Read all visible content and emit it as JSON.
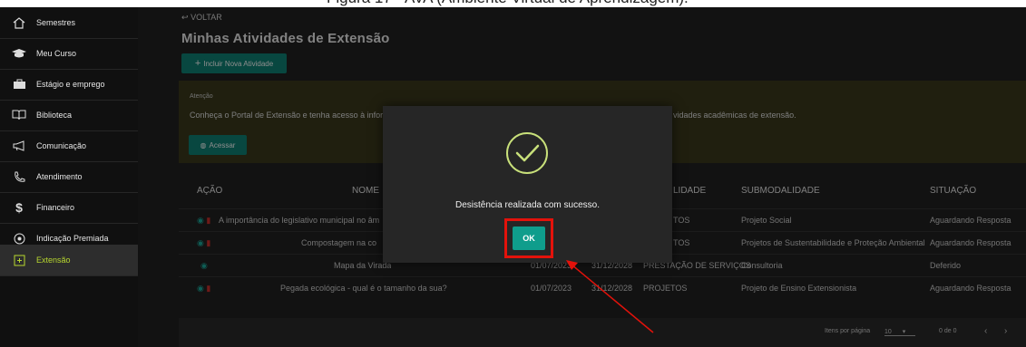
{
  "caption": "Figura 17 - AVA (Ambiente Virtual de Aprendizagem).",
  "sidebar": {
    "items": [
      {
        "label": "Semestres",
        "icon": "home-icon"
      },
      {
        "label": "Meu Curso",
        "icon": "graduation-cap-icon"
      },
      {
        "label": "Estágio e emprego",
        "icon": "briefcase-icon"
      },
      {
        "label": "Biblioteca",
        "icon": "book-icon"
      },
      {
        "label": "Comunicação",
        "icon": "megaphone-icon"
      },
      {
        "label": "Atendimento",
        "icon": "phone-icon"
      },
      {
        "label": "Financeiro",
        "icon": "dollar-icon"
      },
      {
        "label": "Indicação Premiada",
        "icon": "share-icon"
      },
      {
        "label": "Extensão",
        "icon": "extension-icon",
        "active": true
      }
    ]
  },
  "header": {
    "back": "VOLTAR",
    "title": "Minhas Atividades de Extensão",
    "add_button": "Incluir Nova Atividade"
  },
  "notice": {
    "heading": "Atenção",
    "text_left": "Conheça o Portal de Extensão e tenha acesso à infor",
    "text_right": "vidades acadêmicas de extensão.",
    "button": "Acessar"
  },
  "table": {
    "headers": [
      "AÇÃO",
      "NOME",
      "LIDADE",
      "SUBMODALIDADE",
      "SITUAÇÃO"
    ],
    "rows": [
      {
        "nome": "A importância do legislativo municipal no âm",
        "inicio": "",
        "fim": "",
        "modalidade": "TOS",
        "sub": "Projeto Social",
        "situacao": "Aguardando Resposta",
        "delete": true
      },
      {
        "nome": "Compostagem na co",
        "inicio": "",
        "fim": "",
        "modalidade": "TOS",
        "sub": "Projetos de Sustentabilidade e Proteção Ambiental",
        "situacao": "Aguardando Resposta",
        "delete": true
      },
      {
        "nome": "Mapa da Virada",
        "inicio": "01/07/2023",
        "fim": "31/12/2028",
        "modalidade": "PRESTAÇÃO DE SERVIÇOS",
        "sub": "Consultoria",
        "situacao": "Deferido",
        "delete": false
      },
      {
        "nome": "Pegada ecológica - qual é o tamanho da sua?",
        "inicio": "01/07/2023",
        "fim": "31/12/2028",
        "modalidade": "PROJETOS",
        "sub": "Projeto de Ensino Extensionista",
        "situacao": "Aguardando Resposta",
        "delete": true
      }
    ],
    "footer": {
      "per_page_label": "Itens por página",
      "per_page_value": "10",
      "range": "0 de 0"
    }
  },
  "modal": {
    "message": "Desistência realizada com sucesso.",
    "ok": "OK"
  },
  "colors": {
    "accent": "#0f8276",
    "active": "#b7d62f",
    "highlight": "#e3120b"
  }
}
